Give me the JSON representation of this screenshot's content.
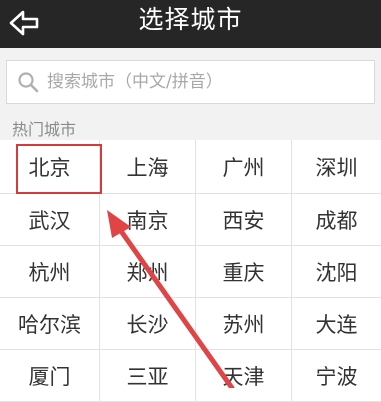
{
  "header": {
    "title": "选择城市",
    "back_icon": "back-arrow-icon"
  },
  "search": {
    "placeholder": "搜索城市（中文/拼音）",
    "icon": "search-icon"
  },
  "hot_cities": {
    "label": "热门城市",
    "cities": [
      "北京",
      "上海",
      "广州",
      "深圳",
      "武汉",
      "南京",
      "西安",
      "成都",
      "杭州",
      "郑州",
      "重庆",
      "沈阳",
      "哈尔滨",
      "长沙",
      "苏州",
      "大连",
      "厦门",
      "三亚",
      "天津",
      "宁波"
    ]
  },
  "colors": {
    "header_bg": "#262626",
    "highlight": "#d83a3a",
    "arrow": "#e04444"
  }
}
